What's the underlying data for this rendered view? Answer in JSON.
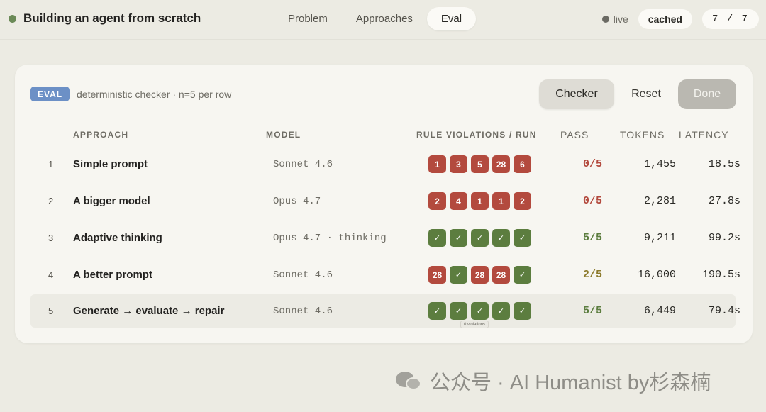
{
  "header": {
    "title": "Building an agent from scratch",
    "tabs": [
      {
        "label": "Problem",
        "active": false
      },
      {
        "label": "Approaches",
        "active": false
      },
      {
        "label": "Eval",
        "active": true
      }
    ],
    "live_label": "live",
    "cached_label": "cached",
    "pager": "7 / 7"
  },
  "panel": {
    "badge": "EVAL",
    "description": "deterministic checker · n=5 per row",
    "buttons": {
      "checker": "Checker",
      "reset": "Reset",
      "done": "Done"
    }
  },
  "table": {
    "columns": {
      "approach": "APPROACH",
      "model": "MODEL",
      "violations": "RULE VIOLATIONS / RUN",
      "pass": "PASS",
      "tokens": "TOKENS",
      "latency": "LATENCY"
    },
    "rows": [
      {
        "index": "1",
        "approach": "Simple prompt",
        "model": "Sonnet 4.6",
        "runs": [
          "1",
          "3",
          "5",
          "28",
          "6"
        ],
        "pass": "0/5",
        "pass_status": "zero",
        "tokens": "1,455",
        "latency": "18.5s"
      },
      {
        "index": "2",
        "approach": "A bigger model",
        "model": "Opus 4.7",
        "runs": [
          "2",
          "4",
          "1",
          "1",
          "2"
        ],
        "pass": "0/5",
        "pass_status": "zero",
        "tokens": "2,281",
        "latency": "27.8s"
      },
      {
        "index": "3",
        "approach": "Adaptive thinking",
        "model": "Opus 4.7 · thinking",
        "runs": [
          "✓",
          "✓",
          "✓",
          "✓",
          "✓"
        ],
        "pass": "5/5",
        "pass_status": "full",
        "tokens": "9,211",
        "latency": "99.2s"
      },
      {
        "index": "4",
        "approach": "A better prompt",
        "model": "Sonnet 4.6",
        "runs": [
          "28",
          "✓",
          "28",
          "28",
          "✓"
        ],
        "pass": "2/5",
        "pass_status": "partial",
        "tokens": "16,000",
        "latency": "190.5s"
      },
      {
        "index": "5",
        "approach": "Generate → evaluate → repair",
        "model": "Sonnet 4.6",
        "runs": [
          "✓",
          "✓",
          "✓",
          "✓",
          "✓"
        ],
        "pass": "5/5",
        "pass_status": "full",
        "tokens": "6,449",
        "latency": "79.4s",
        "highlighted": true
      }
    ],
    "tooltip": "0 violations"
  },
  "watermark": "公众号 · AI Humanist by杉森楠",
  "colors": {
    "fail": "#b34a3e",
    "ok": "#5c7d3f",
    "partial": "#8c7a2c",
    "badge": "#6c90c6"
  }
}
